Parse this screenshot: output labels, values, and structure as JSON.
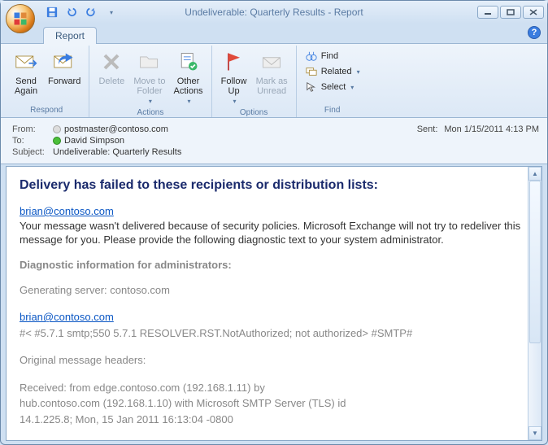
{
  "window": {
    "title": "Undeliverable: Quarterly Results - Report"
  },
  "tabs": {
    "report": "Report"
  },
  "ribbon": {
    "respond": {
      "label": "Respond",
      "send_again": "Send\nAgain",
      "forward": "Forward"
    },
    "actions": {
      "label": "Actions",
      "delete": "Delete",
      "move_to_folder": "Move to\nFolder",
      "other_actions": "Other\nActions"
    },
    "options": {
      "label": "Options",
      "follow_up": "Follow\nUp",
      "mark_unread": "Mark as\nUnread"
    },
    "find": {
      "label": "Find",
      "find": "Find",
      "related": "Related",
      "select": "Select"
    }
  },
  "header": {
    "from_label": "From:",
    "from_value": "postmaster@contoso.com",
    "to_label": "To:",
    "to_value": "David Simpson",
    "subject_label": "Subject:",
    "subject_value": "Undeliverable: Quarterly Results",
    "sent_label": "Sent:",
    "sent_value": "Mon 1/15/2011 4:13 PM"
  },
  "body": {
    "heading": "Delivery has failed to these recipients or distribution lists:",
    "recipient": "brian@contoso.com",
    "explain": "Your message wasn't delivered because of security policies. Microsoft Exchange will not try to redeliver this message for you. Please provide the following diagnostic text to your system administrator.",
    "diag_head": "Diagnostic information for administrators:",
    "gen_server": "Generating server: contoso.com",
    "recipient2": "brian@contoso.com",
    "smtp_line": "#< #5.7.1 smtp;550 5.7.1 RESOLVER.RST.NotAuthorized; not authorized> #SMTP#",
    "orig_head": "Original message headers:",
    "received1": "Received: from edge.contoso.com (192.168.1.11) by",
    "received2": " hub.contoso.com (192.168.1.10) with Microsoft SMTP Server (TLS) id",
    "received3": " 14.1.225.8;  Mon, 15 Jan 2011 16:13:04 -0800"
  }
}
